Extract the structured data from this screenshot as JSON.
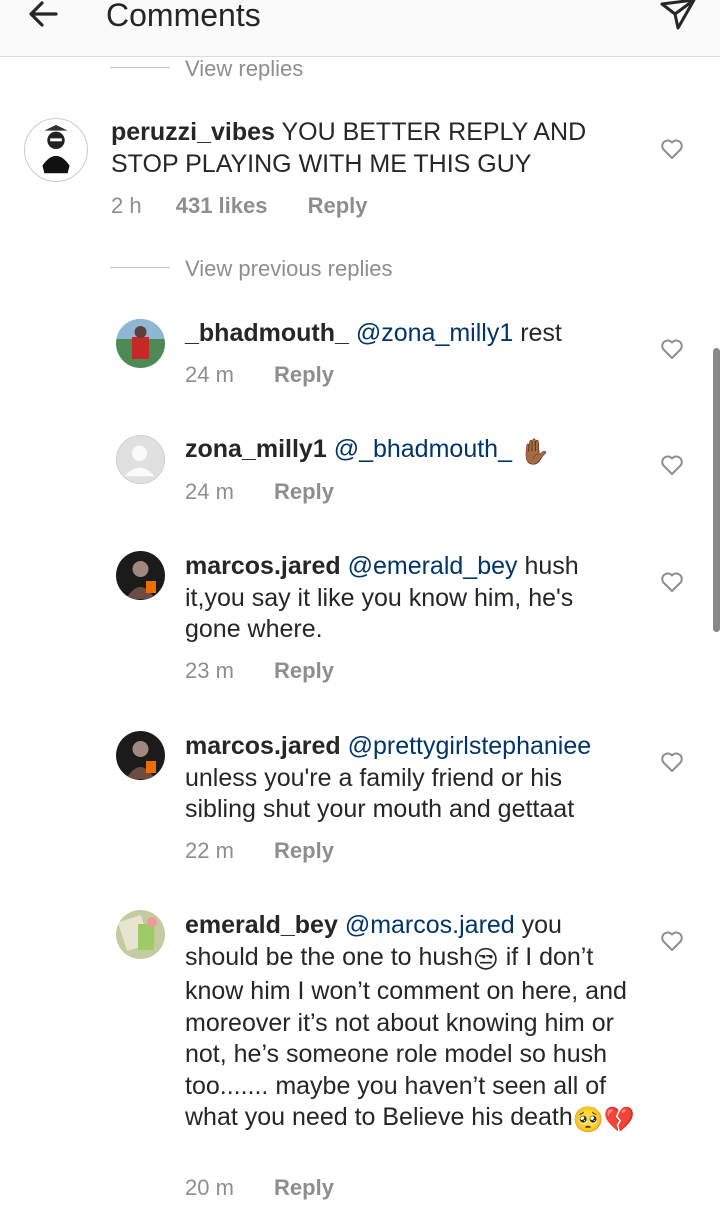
{
  "header": {
    "title": "Comments",
    "back_icon": "arrow-left-icon",
    "send_icon": "paper-plane-icon"
  },
  "links": {
    "view_replies": "View replies",
    "view_previous": "View previous replies"
  },
  "main_comment": {
    "username": "peruzzi_vibes",
    "text": "YOU BETTER REPLY AND STOP PLAYING WITH ME THIS GUY",
    "time": "2 h",
    "likes": "431 likes",
    "reply_label": "Reply"
  },
  "replies": [
    {
      "username": "_bhadmouth_",
      "mention": "@zona_milly1",
      "text": "rest",
      "time": "24 m",
      "reply_label": "Reply"
    },
    {
      "username": "zona_milly1",
      "mention": "@_bhadmouth_",
      "text": "✋🏾",
      "time": "24 m",
      "reply_label": "Reply"
    },
    {
      "username": "marcos.jared",
      "mention": "@emerald_bey",
      "text": "hush it,you say it like you know him, he's gone where.",
      "time": "23 m",
      "reply_label": "Reply"
    },
    {
      "username": "marcos.jared",
      "mention": "@prettygirlstephaniee",
      "text": "unless you're a family friend or his sibling shut your mouth and gettaat",
      "time": "22 m",
      "reply_label": "Reply"
    },
    {
      "username": "emerald_bey",
      "mention": "@marcos.jared",
      "text_1": "you should be the one to hush",
      "emoji_1": "😒",
      "text_2": "if I don’t know him I won’t comment on here, and moreover it’s not about knowing him or not, he’s someone role model so hush too....... maybe you haven’t seen all of what you need to Believe his death",
      "emoji_2": "🥺💔",
      "time": "20 m",
      "reply_label": "Reply"
    }
  ],
  "icons": {
    "like": "heart-outline-icon"
  }
}
